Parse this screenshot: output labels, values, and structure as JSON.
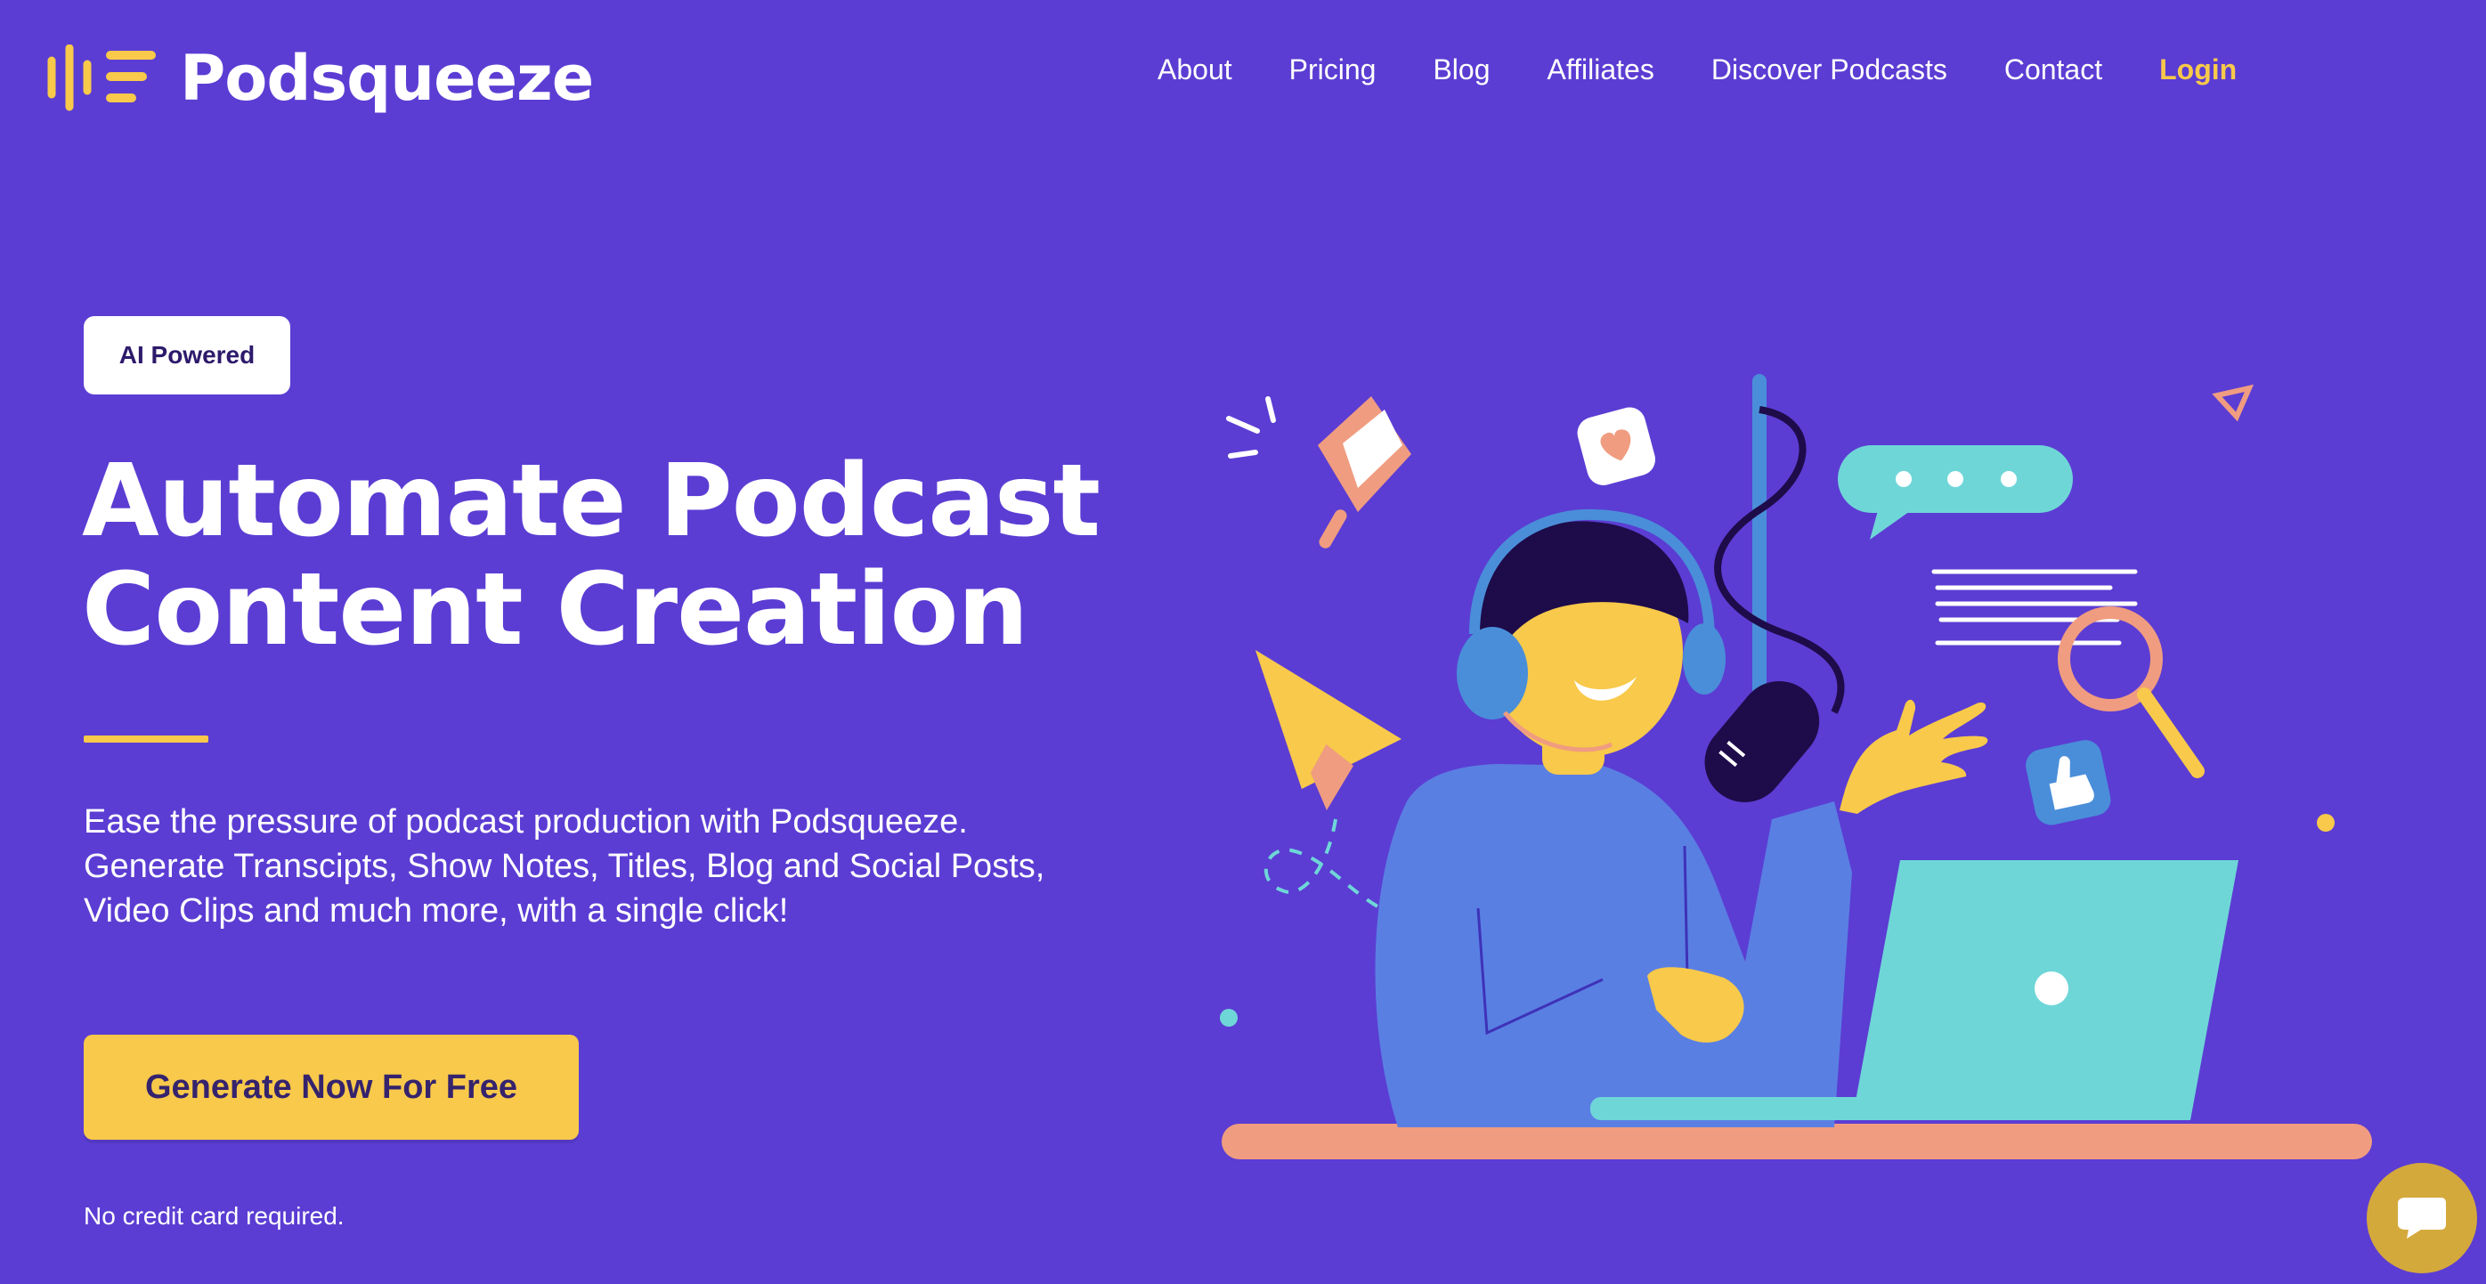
{
  "brand": {
    "name": "Podsqueeze",
    "logo_icon": "soundwave-lines-icon",
    "accent": "#f8c94a",
    "background": "#5b3dd3"
  },
  "nav": {
    "items": [
      {
        "label": "About"
      },
      {
        "label": "Pricing"
      },
      {
        "label": "Blog"
      },
      {
        "label": "Affiliates"
      },
      {
        "label": "Discover Podcasts"
      },
      {
        "label": "Contact"
      }
    ],
    "login": "Login"
  },
  "hero": {
    "badge": "AI Powered",
    "headline": [
      "Automate Podcast",
      "Content Creation"
    ],
    "description": [
      "Ease the pressure of podcast production with Podsqueeze.",
      "Generate Transcipts, Show Notes, Titles, Blog and Social Posts,",
      "Video Clips and much more, with a single click!"
    ],
    "cta": "Generate Now For Free",
    "note": "No credit card required."
  },
  "illustration": {
    "subject": "podcaster-with-microphone-and-laptop",
    "icons": [
      "megaphone-icon",
      "heart-icon",
      "chat-bubble-icon",
      "paper-plane-icon",
      "magnifier-icon",
      "thumbs-up-icon",
      "triangle-icon"
    ]
  },
  "chat_widget": {
    "icon": "chat-icon",
    "color": "#d4a93c"
  }
}
